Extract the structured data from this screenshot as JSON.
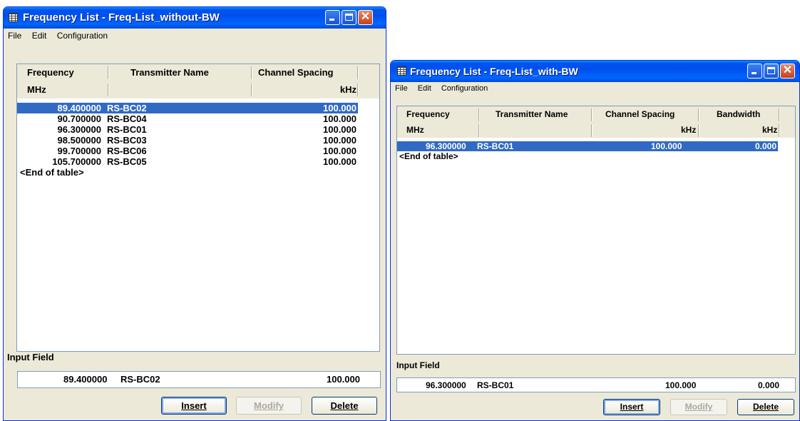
{
  "windows": [
    {
      "title": "Frequency List - Freq-List_without-BW",
      "menu": [
        "File",
        "Edit",
        "Configuration"
      ],
      "columns": [
        "Frequency",
        "Transmitter Name",
        "Channel Spacing"
      ],
      "units": [
        "MHz",
        "",
        "kHz"
      ],
      "rows": [
        {
          "freq": "89.400000",
          "name": "RS-BC02",
          "spacing": "100.000"
        },
        {
          "freq": "90.700000",
          "name": "RS-BC04",
          "spacing": "100.000"
        },
        {
          "freq": "96.300000",
          "name": "RS-BC01",
          "spacing": "100.000"
        },
        {
          "freq": "98.500000",
          "name": "RS-BC03",
          "spacing": "100.000"
        },
        {
          "freq": "99.700000",
          "name": "RS-BC06",
          "spacing": "100.000"
        },
        {
          "freq": "105.700000",
          "name": "RS-BC05",
          "spacing": "100.000"
        }
      ],
      "selected_row": 0,
      "end_of_table": "<End of table>",
      "input_label": "Input Field",
      "input": {
        "freq": "89.400000",
        "name": "RS-BC02",
        "spacing": "100.000"
      },
      "buttons": {
        "insert": "Insert",
        "modify": "Modify",
        "delete": "Delete"
      }
    },
    {
      "title": "Frequency List - Freq-List_with-BW",
      "menu": [
        "File",
        "Edit",
        "Configuration"
      ],
      "columns": [
        "Frequency",
        "Transmitter Name",
        "Channel Spacing",
        "Bandwidth"
      ],
      "units": [
        "MHz",
        "",
        "kHz",
        "kHz"
      ],
      "rows": [
        {
          "freq": "96.300000",
          "name": "RS-BC01",
          "spacing": "100.000",
          "bandwidth": "0.000"
        }
      ],
      "selected_row": 0,
      "end_of_table": "<End of table>",
      "input_label": "Input Field",
      "input": {
        "freq": "96.300000",
        "name": "RS-BC01",
        "spacing": "100.000",
        "bandwidth": "0.000"
      },
      "buttons": {
        "insert": "Insert",
        "modify": "Modify",
        "delete": "Delete"
      }
    }
  ]
}
